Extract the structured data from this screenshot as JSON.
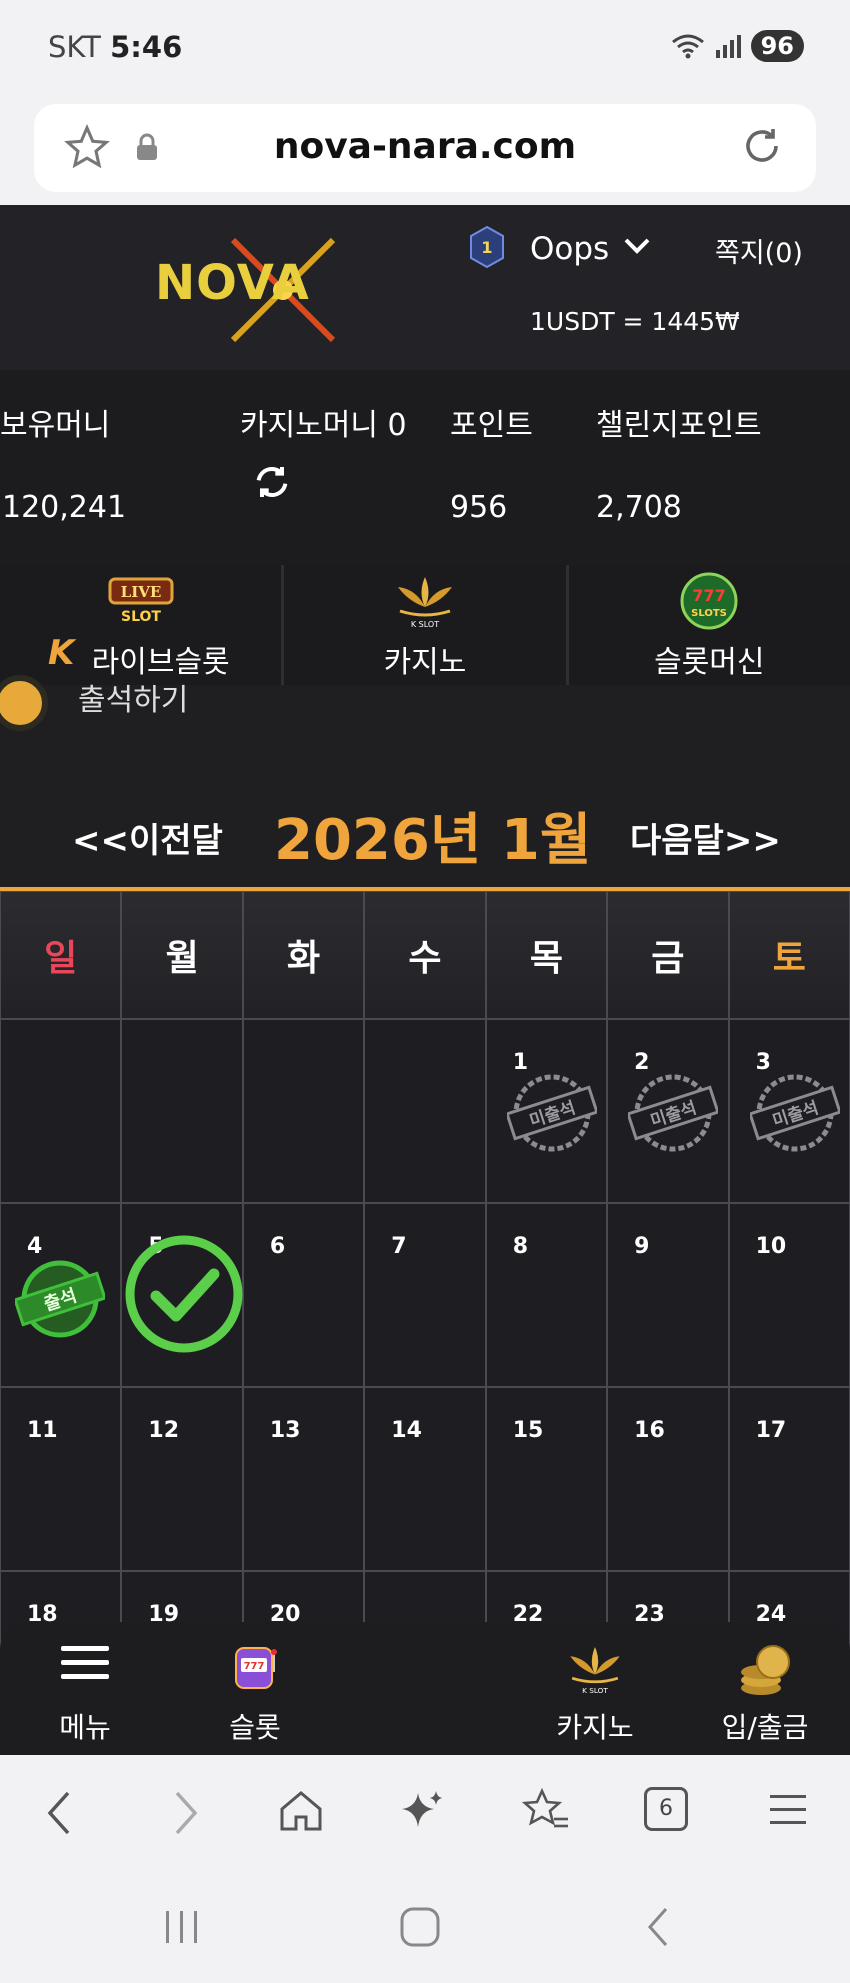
{
  "status_bar": {
    "carrier": "SKT",
    "time": "5:46",
    "battery": "96"
  },
  "browser": {
    "url": "nova-nara.com",
    "tab_count": "6"
  },
  "header": {
    "logo": "NOVA",
    "rank": "1",
    "username": "Oops",
    "messages": "쪽지(0)",
    "exchange_rate": "1USDT = 1445₩"
  },
  "balances": {
    "holding_label": "보유머니",
    "holding_value": "120,241",
    "casino_label": "카지노머니 0",
    "point_label": "포인트",
    "point_value": "956",
    "challenge_label": "챌린지포인트",
    "challenge_value": "2,708"
  },
  "game_tabs": [
    {
      "label": "라이브슬롯",
      "icon": "live-slot-icon"
    },
    {
      "label": "카지노",
      "icon": "kslot-lotus-icon"
    },
    {
      "label": "슬롯머신",
      "icon": "777-slots-icon"
    }
  ],
  "attendance": {
    "title": "출석하기",
    "prev": "<<이전달",
    "month": "2026년 1월",
    "next": "다음달>>",
    "weekdays": [
      "일",
      "월",
      "화",
      "수",
      "목",
      "금",
      "토"
    ],
    "weekday_colors": {
      "sun": "#e8475a",
      "sat": "#f0a53c",
      "other": "#ffffff"
    },
    "weeks": [
      [
        {
          "day": "",
          "status": ""
        },
        {
          "day": "",
          "status": ""
        },
        {
          "day": "",
          "status": ""
        },
        {
          "day": "",
          "status": ""
        },
        {
          "day": "1",
          "status": "미출석"
        },
        {
          "day": "2",
          "status": "미출석"
        },
        {
          "day": "3",
          "status": "미출석"
        }
      ],
      [
        {
          "day": "4",
          "status": "출석"
        },
        {
          "day": "5",
          "status": "check"
        },
        {
          "day": "6",
          "status": ""
        },
        {
          "day": "7",
          "status": ""
        },
        {
          "day": "8",
          "status": ""
        },
        {
          "day": "9",
          "status": ""
        },
        {
          "day": "10",
          "status": ""
        }
      ],
      [
        {
          "day": "11",
          "status": ""
        },
        {
          "day": "12",
          "status": ""
        },
        {
          "day": "13",
          "status": ""
        },
        {
          "day": "14",
          "status": ""
        },
        {
          "day": "15",
          "status": ""
        },
        {
          "day": "16",
          "status": ""
        },
        {
          "day": "17",
          "status": ""
        }
      ],
      [
        {
          "day": "18",
          "status": ""
        },
        {
          "day": "19",
          "status": ""
        },
        {
          "day": "20",
          "status": ""
        },
        {
          "day": "",
          "status": ""
        },
        {
          "day": "22",
          "status": ""
        },
        {
          "day": "23",
          "status": ""
        },
        {
          "day": "24",
          "status": ""
        }
      ]
    ]
  },
  "bottom_nav": [
    {
      "label": "메뉴",
      "icon": "hamburger-icon"
    },
    {
      "label": "슬롯",
      "icon": "slot-machine-icon"
    },
    {
      "label": "",
      "icon": "home-icon"
    },
    {
      "label": "카지노",
      "icon": "kslot-lotus-icon"
    },
    {
      "label": "입/출금",
      "icon": "coins-icon"
    }
  ],
  "colors": {
    "accent": "#f0a53c",
    "stamp_gray": "#8b8b90",
    "stamp_green": "#3fbf3a",
    "check_green": "#5ccf4a"
  }
}
